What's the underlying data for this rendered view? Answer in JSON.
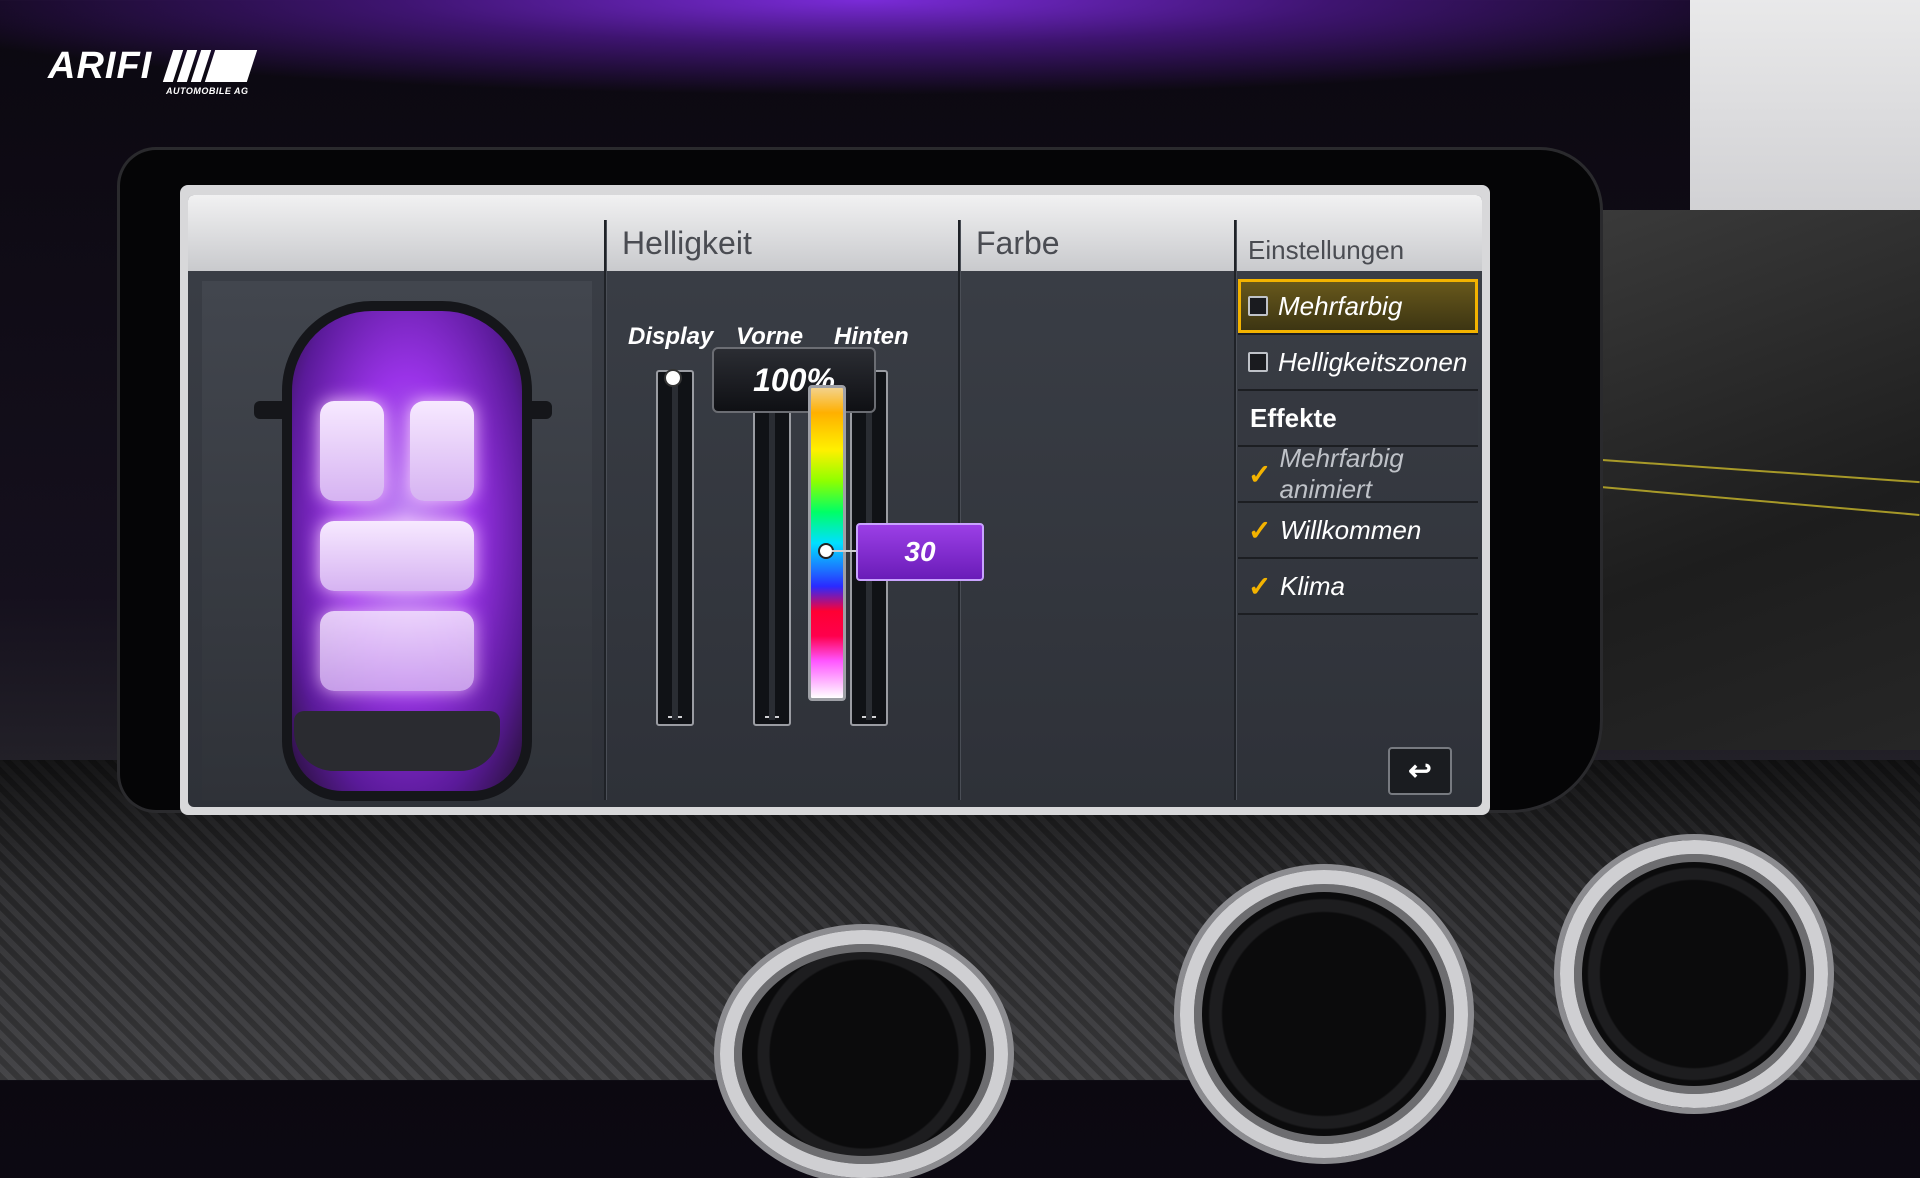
{
  "logo": {
    "main": "ARIFI",
    "sub": "AUTOMOBILE AG"
  },
  "columns": {
    "brightness_title": "Helligkeit",
    "color_title": "Farbe",
    "settings_title": "Einstellungen"
  },
  "brightness": {
    "labels": [
      "Display",
      "Vorne",
      "Hinten"
    ],
    "value": "100%"
  },
  "color": {
    "value": "30"
  },
  "settings": {
    "items": [
      {
        "label": "Mehrfarbig",
        "checked": false,
        "selected": true
      },
      {
        "label": "Helligkeitszonen",
        "checked": false,
        "selected": false
      }
    ],
    "effects_header": "Effekte",
    "effects": [
      {
        "label": "Mehrfarbig animiert",
        "checked": true,
        "dimmed": true
      },
      {
        "label": "Willkommen",
        "checked": true,
        "dimmed": false
      },
      {
        "label": "Klima",
        "checked": true,
        "dimmed": false
      }
    ],
    "back_icon": "back-arrow-icon"
  },
  "colors": {
    "accent_yellow": "#f3b300",
    "ambient_purple": "#9a33e8"
  }
}
